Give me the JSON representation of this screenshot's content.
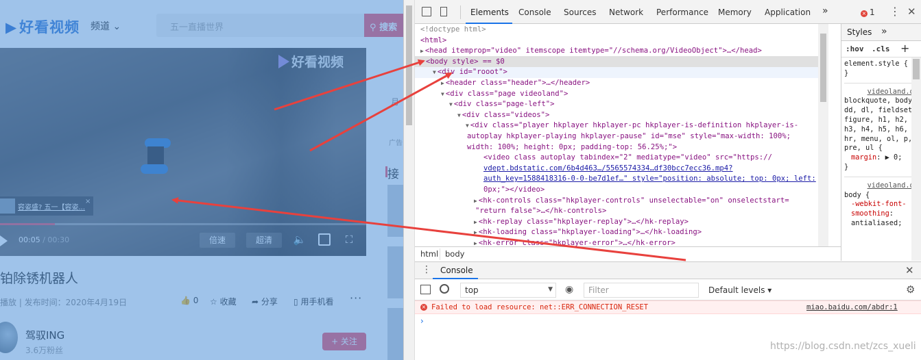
{
  "site": {
    "logo": "好看视频",
    "channel": "频道",
    "search_placeholder": "五一直播世界",
    "search_button": "搜索"
  },
  "player": {
    "watermark": "好看视频",
    "rec_title": "容姿盛? 五一【容姿...",
    "rec_close": "×",
    "current_time": "00:05",
    "total_time": "00:30",
    "progress_fraction": 0.15,
    "speed_label": "倍速",
    "quality_label": "超清"
  },
  "side": {
    "text1": "月",
    "label": "广告",
    "heading": "接"
  },
  "video": {
    "title": "铂除锈机器人",
    "meta": "播放 | 发布时间：2020年4月19日",
    "like": "0",
    "favorite": "收藏",
    "share": "分享",
    "mobile": "用手机看",
    "more": "···"
  },
  "author": {
    "name": "驾驭ING",
    "fans": "3.6万粉丝",
    "follow": "+ 关注"
  },
  "devtools": {
    "tabs": [
      "Elements",
      "Console",
      "Sources",
      "Network",
      "Performance",
      "Memory",
      "Application"
    ],
    "error_count": "1",
    "tree": [
      {
        "text": "<!doctype html>"
      },
      {
        "text": "<html>"
      },
      {
        "text": "<head itemprop=\"video\" itemscope itemtype=\"//schema.org/VideoObject\">…</head>"
      },
      {
        "text": "<body style> == $0"
      },
      {
        "text": "<div id=\"rooot\">"
      },
      {
        "text": "<header class=\"header\">…</header>"
      },
      {
        "text": "<div class=\"page videoland\">"
      },
      {
        "text": "<div class=\"page-left\">"
      },
      {
        "text": "<div class=\"videos\">"
      },
      {
        "text": "<div class=\"player hkplayer hkplayer-pc hkplayer-is-definition hkplayer-is-"
      },
      {
        "text": "autoplay hkplayer-playing hkplayer-pause\" id=\"mse\" style=\"max-width: 100%;"
      },
      {
        "text": "width: 100%; height: 0px; padding-top: 56.25%;\">"
      },
      {
        "text": "<video class autoplay tabindex=\"2\" mediatype=\"video\" src=\"https://"
      },
      {
        "text": "vdept.bdstatic.com/6b4d463…/5565574334…df30bcc7ecc36.mp4?"
      },
      {
        "text": "auth_key=1588418316-0-0-be7d1ef…\" style=\"position: absolute; top: 0px; left:"
      },
      {
        "text": "0px;\"></video>"
      },
      {
        "text": "<hk-controls class=\"hkplayer-controls\" unselectable=\"on\" onselectstart="
      },
      {
        "text": "\"return false\">…</hk-controls>"
      },
      {
        "text": "<hk-replay class=\"hkplayer-replay\">…</hk-replay>"
      },
      {
        "text": "<hk-loading class=\"hkplayer-loading\">…</hk-loading>"
      },
      {
        "text": "<hk-error class=\"hkplayer-error\">…</hk-error>"
      }
    ],
    "breadcrumbs": [
      "html",
      "body"
    ],
    "styles": {
      "tab": "Styles",
      "hov": ":hov",
      "cls": ".cls",
      "plus": "+",
      "element_style": "element.style {",
      "close": "}",
      "src1": "videoland.d…",
      "selectors1": "blockquote, body, dd, dl, fieldset, figure, h1, h2, h3, h4, h5, h6, hr, menu, ol, p, pre, ul {",
      "prop1": "margin",
      "val1": "▶ 0;",
      "src2": "videoland.d…",
      "selectors2": "body {",
      "prop2": "-webkit-font-smoothing",
      "val2": "antialiased;"
    },
    "drawer": {
      "tab": "Console",
      "context": "top",
      "filter_placeholder": "Filter",
      "levels": "Default levels ▾",
      "error_message": "Failed to load resource: net::ERR_CONNECTION_RESET",
      "error_source": "miao.baidu.com/abdr:1",
      "prompt": "›"
    }
  },
  "watermark": "https://blog.csdn.net/zcs_xueli",
  "colors": {
    "overlay": "#468cd7",
    "accent": "#f0566e",
    "link": "#1a73e8",
    "error": "#d8240b",
    "arrow": "#e8413d"
  }
}
